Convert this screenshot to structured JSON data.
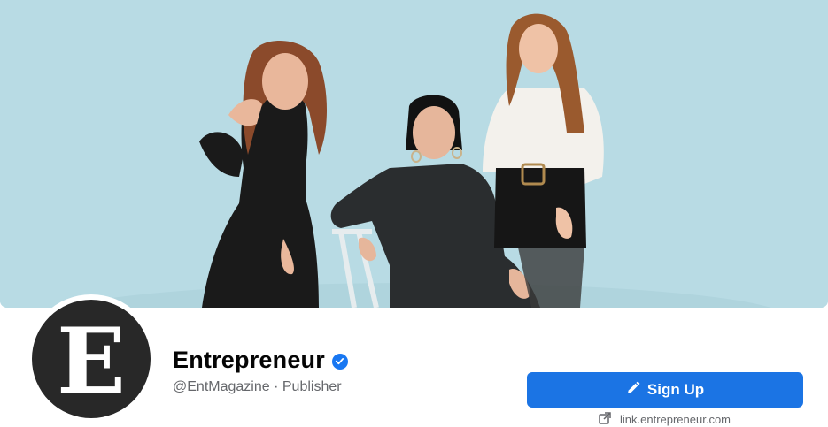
{
  "cover": {
    "alt_icon": "cover-photo"
  },
  "profile": {
    "avatar_letter": "E",
    "name": "Entrepreneur",
    "handle": "@EntMagazine",
    "separator": "·",
    "category": "Publisher",
    "verified_icon": "verified-badge-icon"
  },
  "actions": {
    "signup_label": "Sign Up",
    "signup_icon": "pencil-icon",
    "link_text": "link.entrepreneur.com",
    "link_icon": "external-link-icon"
  },
  "colors": {
    "accent": "#1b74e4",
    "verified": "#1877f2",
    "muted_text": "#65676b",
    "cover_bg": "#b6d9e3"
  }
}
